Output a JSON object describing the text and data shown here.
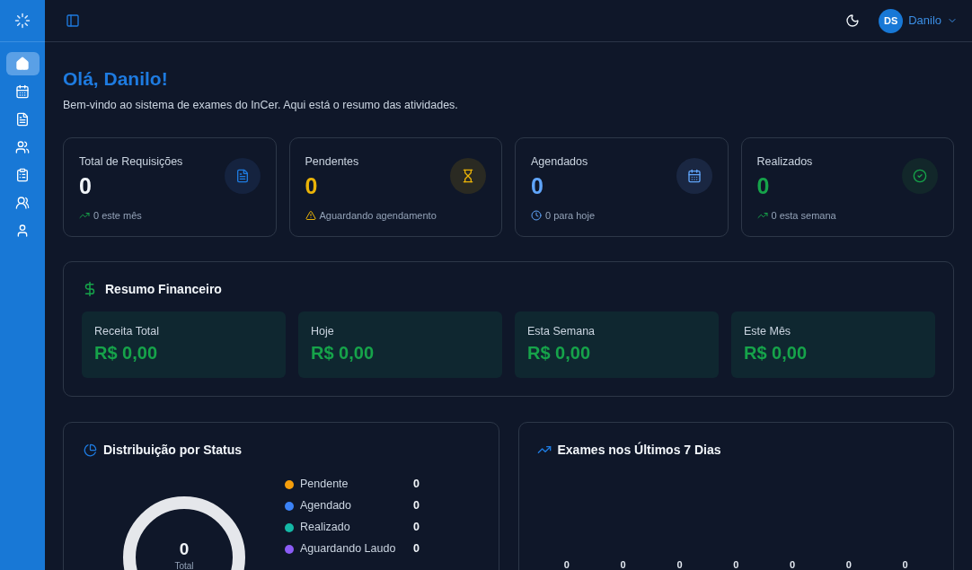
{
  "sidebar": {
    "items": [
      {
        "selected": true
      },
      {
        "selected": false
      },
      {
        "selected": false
      },
      {
        "selected": false
      },
      {
        "selected": false
      },
      {
        "selected": false
      },
      {
        "selected": false
      }
    ]
  },
  "header": {
    "avatar_initials": "DS",
    "user_name": "Danilo"
  },
  "greeting": {
    "title": "Olá, Danilo!",
    "subtitle": "Bem-vindo ao sistema de exames do InCer. Aqui está o resumo das atividades."
  },
  "stat_cards": [
    {
      "label": "Total de Requisições",
      "value": "0",
      "note": "0 este mês",
      "color": "#f1f5f9"
    },
    {
      "label": "Pendentes",
      "value": "0",
      "note": "Aguardando agendamento",
      "color": "#eab308"
    },
    {
      "label": "Agendados",
      "value": "0",
      "note": "0 para hoje",
      "color": "#60a5fa"
    },
    {
      "label": "Realizados",
      "value": "0",
      "note": "0 esta semana",
      "color": "#16a34a"
    }
  ],
  "financial": {
    "title": "Resumo Financeiro",
    "items": [
      {
        "label": "Receita Total",
        "value": "R$ 0,00"
      },
      {
        "label": "Hoje",
        "value": "R$ 0,00"
      },
      {
        "label": "Esta Semana",
        "value": "R$ 0,00"
      },
      {
        "label": "Este Mês",
        "value": "R$ 0,00"
      }
    ]
  },
  "status_distribution": {
    "title": "Distribuição por Status",
    "total": "0",
    "total_label": "Total",
    "legend": [
      {
        "label": "Pendente",
        "value": "0",
        "color": "#f59e0b"
      },
      {
        "label": "Agendado",
        "value": "0",
        "color": "#3b82f6"
      },
      {
        "label": "Realizado",
        "value": "0",
        "color": "#14b8a6"
      },
      {
        "label": "Aguardando Laudo",
        "value": "0",
        "color": "#8b5cf6"
      }
    ]
  },
  "exams_chart": {
    "title": "Exames nos Últimos 7 Dias",
    "value_labels": [
      "0",
      "0",
      "0",
      "0",
      "0",
      "0",
      "0"
    ]
  }
}
